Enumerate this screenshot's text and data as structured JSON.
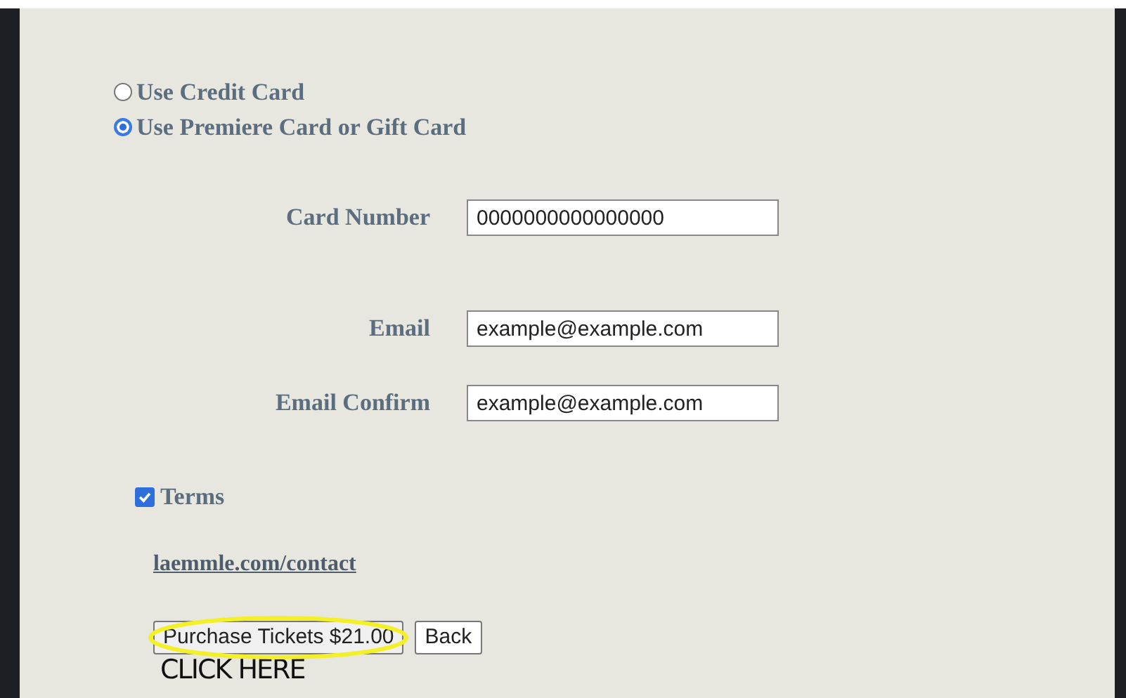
{
  "payment_options": [
    {
      "label": "Use Credit Card",
      "selected": false
    },
    {
      "label": "Use Premiere Card or Gift Card",
      "selected": true
    }
  ],
  "fields": [
    {
      "label": "Card Number",
      "value": "0000000000000000"
    },
    {
      "label": "Email",
      "value": "example@example.com"
    },
    {
      "label": "Email Confirm",
      "value": "example@example.com"
    }
  ],
  "terms": {
    "label": "Terms",
    "checked": true
  },
  "contact_link": "laemmle.com/contact",
  "buttons": [
    {
      "label": "Purchase Tickets $21.00",
      "kind": "primary"
    },
    {
      "label": "Back",
      "kind": "secondary"
    }
  ],
  "annotation": {
    "text": "CLICK HERE"
  }
}
